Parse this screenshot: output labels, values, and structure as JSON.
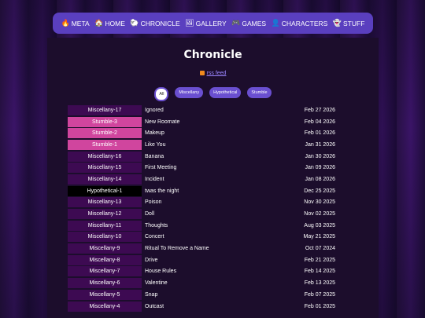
{
  "nav": [
    {
      "icon": "🔥",
      "label": "META"
    },
    {
      "icon": "🏠",
      "label": "HOME"
    },
    {
      "icon": "🐑",
      "label": "CHRONICLE"
    },
    {
      "icon": "🖼",
      "label": "GALLERY"
    },
    {
      "icon": "🎮",
      "label": "GAMES"
    },
    {
      "icon": "👤",
      "label": "CHARACTERS"
    },
    {
      "icon": "👻",
      "label": "STUFF"
    }
  ],
  "page_title": "Chronicle",
  "rss_label": "rss feed",
  "filters": [
    "All",
    "Miscellany",
    "Hypothetical",
    "Stumble"
  ],
  "colors": {
    "nav_bg": "#5a3fbf",
    "misc": "#3d0a52",
    "stumble": "#d0459e",
    "hypothetical": "#000000",
    "link": "#9a86ff"
  },
  "entries": [
    {
      "tag": "Miscellany-17",
      "type": "misc",
      "title": "Ignored",
      "date": "Feb 27 2026"
    },
    {
      "tag": "Stumble-3",
      "type": "stumble",
      "title": "New Roomate",
      "date": "Feb 04 2026"
    },
    {
      "tag": "Stumble-2",
      "type": "stumble",
      "title": "Makeup",
      "date": "Feb 01 2026"
    },
    {
      "tag": "Stumble-1",
      "type": "stumble",
      "title": "Like You",
      "date": "Jan 31 2026"
    },
    {
      "tag": "Miscellany-16",
      "type": "misc",
      "title": "Banana",
      "date": "Jan 30 2026"
    },
    {
      "tag": "Miscellany-15",
      "type": "misc",
      "title": "First Meeting",
      "date": "Jan 09 2026"
    },
    {
      "tag": "Miscellany-14",
      "type": "misc",
      "title": "Incident",
      "date": "Jan 08 2026"
    },
    {
      "tag": "Hypothetical-1",
      "type": "hypo",
      "title": "twas the night",
      "date": "Dec 25 2025"
    },
    {
      "tag": "Miscellany-13",
      "type": "misc",
      "title": "Poison",
      "date": "Nov 30 2025"
    },
    {
      "tag": "Miscellany-12",
      "type": "misc",
      "title": "Doll",
      "date": "Nov 02 2025"
    },
    {
      "tag": "Miscellany-11",
      "type": "misc",
      "title": "Thoughts",
      "date": "Aug 03 2025"
    },
    {
      "tag": "Miscellany-10",
      "type": "misc",
      "title": "Concert",
      "date": "May 21 2025"
    },
    {
      "tag": "Miscellany-9",
      "type": "misc",
      "title": "Ritual To Remove a Name",
      "date": "Oct 07 2024"
    },
    {
      "tag": "Miscellany-8",
      "type": "misc",
      "title": "Drive",
      "date": "Feb 21 2025"
    },
    {
      "tag": "Miscellany-7",
      "type": "misc",
      "title": "House Rules",
      "date": "Feb 14 2025"
    },
    {
      "tag": "Miscellany-6",
      "type": "misc",
      "title": "Valentine",
      "date": "Feb 13 2025"
    },
    {
      "tag": "Miscellany-5",
      "type": "misc",
      "title": "Snap",
      "date": "Feb 07 2025"
    },
    {
      "tag": "Miscellany-4",
      "type": "misc",
      "title": "Outcast",
      "date": "Feb 01 2025"
    }
  ]
}
